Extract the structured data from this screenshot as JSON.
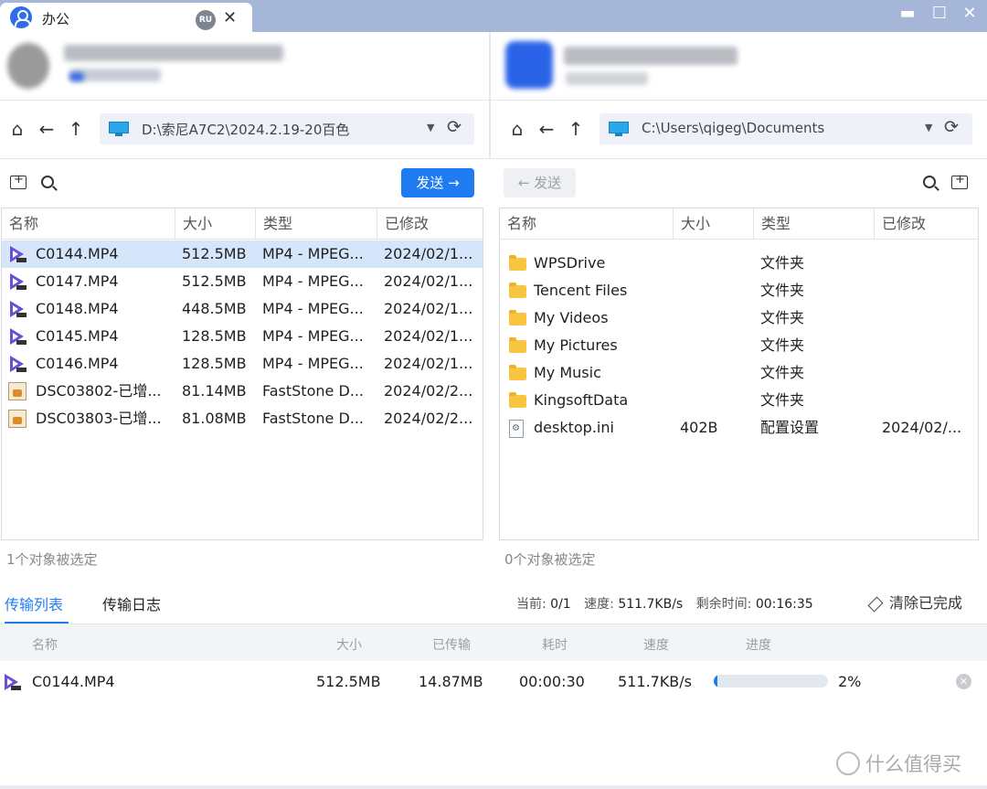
{
  "window": {
    "tab_title": "办公",
    "tab_badge": "RU",
    "tab_close": "✕",
    "minimize": "▬",
    "maximize": "☐",
    "close": "✕"
  },
  "left": {
    "path": "D:\\索尼A7C2\\2024.2.19-20百色",
    "send_label": "发送 →",
    "columns": [
      "名称",
      "大小",
      "类型",
      "已修改"
    ],
    "rows": [
      {
        "name": "C0144.MP4",
        "size": "512.5MB",
        "type": "MP4 - MPEG...",
        "modified": "2024/02/1...",
        "icon": "video-icon",
        "selected": true
      },
      {
        "name": "C0147.MP4",
        "size": "512.5MB",
        "type": "MP4 - MPEG...",
        "modified": "2024/02/1...",
        "icon": "video-icon"
      },
      {
        "name": "C0148.MP4",
        "size": "448.5MB",
        "type": "MP4 - MPEG...",
        "modified": "2024/02/1...",
        "icon": "video-icon"
      },
      {
        "name": "C0145.MP4",
        "size": "128.5MB",
        "type": "MP4 - MPEG...",
        "modified": "2024/02/1...",
        "icon": "video-icon"
      },
      {
        "name": "C0146.MP4",
        "size": "128.5MB",
        "type": "MP4 - MPEG...",
        "modified": "2024/02/1...",
        "icon": "video-icon"
      },
      {
        "name": "DSC03802-已增...",
        "size": "81.14MB",
        "type": "FastStone D...",
        "modified": "2024/02/2...",
        "icon": "image-icon"
      },
      {
        "name": "DSC03803-已增...",
        "size": "81.08MB",
        "type": "FastStone D...",
        "modified": "2024/02/2...",
        "icon": "image-icon"
      }
    ],
    "status": "1个对象被选定"
  },
  "right": {
    "path": "C:\\Users\\qigeg\\Documents",
    "send_label": "← 发送",
    "columns": [
      "名称",
      "大小",
      "类型",
      "已修改"
    ],
    "rows": [
      {
        "name": "WPSDrive",
        "size": "",
        "type": "文件夹",
        "modified": "",
        "icon": "folder-icon"
      },
      {
        "name": "Tencent Files",
        "size": "",
        "type": "文件夹",
        "modified": "",
        "icon": "folder-icon"
      },
      {
        "name": "My Videos",
        "size": "",
        "type": "文件夹",
        "modified": "",
        "icon": "folder-icon"
      },
      {
        "name": "My Pictures",
        "size": "",
        "type": "文件夹",
        "modified": "",
        "icon": "folder-icon"
      },
      {
        "name": "My Music",
        "size": "",
        "type": "文件夹",
        "modified": "",
        "icon": "folder-icon"
      },
      {
        "name": "KingsoftData",
        "size": "",
        "type": "文件夹",
        "modified": "",
        "icon": "folder-icon"
      },
      {
        "name": "desktop.ini",
        "size": "402B",
        "type": "配置设置",
        "modified": "2024/02/...",
        "icon": "settings-file-icon"
      }
    ],
    "status": "0个对象被选定"
  },
  "transfer": {
    "tabs": [
      "传输列表",
      "传输日志"
    ],
    "current_label": "当前:",
    "current_value": "0/1",
    "speed_label": "速度:",
    "speed_value": "511.7KB/s",
    "remaining_label": "剩余时间:",
    "remaining_value": "00:16:35",
    "clear_label": "清除已完成",
    "columns": [
      "名称",
      "大小",
      "已传输",
      "耗时",
      "速度",
      "进度"
    ],
    "row": {
      "name": "C0144.MP4",
      "size": "512.5MB",
      "transferred": "14.87MB",
      "elapsed": "00:00:30",
      "speed": "511.7KB/s",
      "progress_text": "2%",
      "progress_fraction": 0.029
    }
  },
  "watermark": "什么值得买",
  "colors": {
    "accent": "#1f7cf0",
    "titlebar": "#a6b6d8",
    "selected_row": "#d5e6fb",
    "folder": "#f9c440",
    "video_icon": "#6a4fd6"
  }
}
